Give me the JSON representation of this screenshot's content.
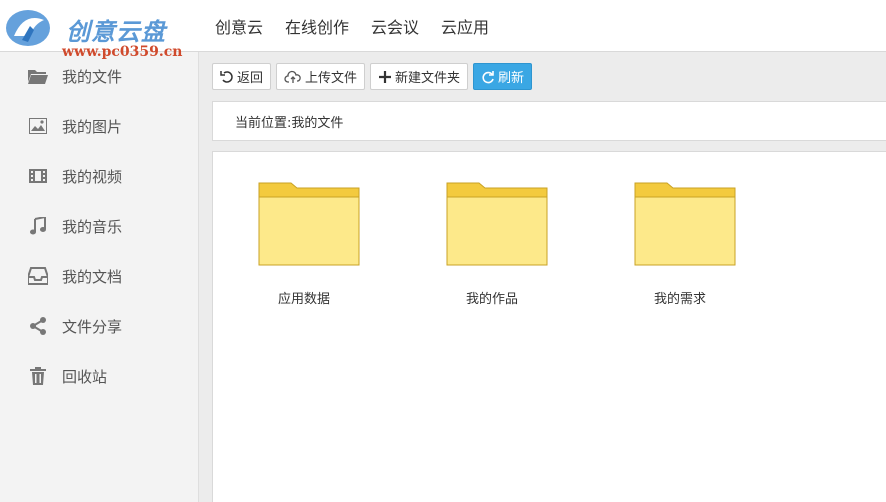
{
  "header": {
    "logo_text": "创意云盘",
    "watermark": "www.pc0359.cn",
    "nav": [
      "创意云",
      "在线创作",
      "云会议",
      "云应用"
    ]
  },
  "sidebar": {
    "items": [
      {
        "label": "我的文件",
        "icon": "folder-icon"
      },
      {
        "label": "我的图片",
        "icon": "image-icon"
      },
      {
        "label": "我的视频",
        "icon": "film-icon"
      },
      {
        "label": "我的音乐",
        "icon": "music-note-icon"
      },
      {
        "label": "我的文档",
        "icon": "inbox-icon"
      },
      {
        "label": "文件分享",
        "icon": "share-icon"
      },
      {
        "label": "回收站",
        "icon": "trash-icon"
      }
    ]
  },
  "toolbar": {
    "back_label": "返回",
    "upload_label": "上传文件",
    "new_folder_label": "新建文件夹",
    "refresh_label": "刷新"
  },
  "breadcrumb": {
    "text": "当前位置:我的文件"
  },
  "folders": [
    {
      "name": "应用数据"
    },
    {
      "name": "我的作品"
    },
    {
      "name": "我的需求"
    }
  ],
  "colors": {
    "accent": "#3aa7e4",
    "folder_body": "#fde98a",
    "folder_tab": "#f3ca3e"
  }
}
